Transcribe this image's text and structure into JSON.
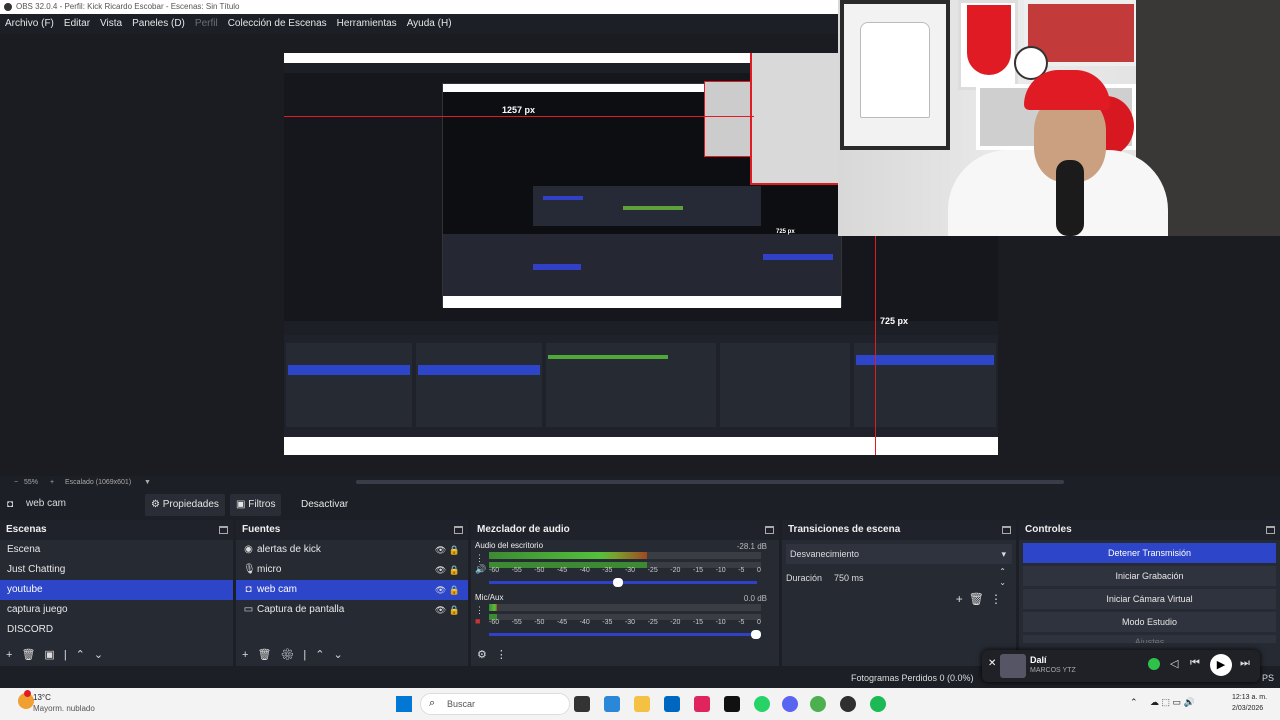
{
  "window": {
    "title": "OBS 32.0.4 - Perfil: Kick Ricardo Escobar - Escenas: Sin Título"
  },
  "menu": {
    "items": [
      "Archivo (F)",
      "Editar",
      "Vista",
      "Paneles (D)",
      "Perfil",
      "Colección de Escenas",
      "Herramientas",
      "Ayuda (H)"
    ]
  },
  "preview": {
    "label_width": "1257 px",
    "label_height": "725 px",
    "label_height_small": "725 px",
    "zoom": "55%",
    "scale_label": "Escalado (1069x601)"
  },
  "source_toolbar": {
    "source_name": "web cam",
    "properties": "Propiedades",
    "filters": "Filtros",
    "deactivate": "Desactivar"
  },
  "scenes": {
    "title": "Escenas",
    "items": [
      "Escena",
      "Just Chatting",
      "youtube",
      "captura juego",
      "DISCORD"
    ],
    "selected": "youtube"
  },
  "sources": {
    "title": "Fuentes",
    "items": [
      {
        "name": "alertas de kick",
        "icon": "globe-icon"
      },
      {
        "name": "micro",
        "icon": "microphone-icon"
      },
      {
        "name": "web cam",
        "icon": "camera-icon"
      },
      {
        "name": "Captura de pantalla",
        "icon": "monitor-icon"
      }
    ],
    "selected": "web cam"
  },
  "mixer": {
    "title": "Mezclador de audio",
    "channels": [
      {
        "name": "Audio del escritorio",
        "db": "-28.1 dB",
        "level": 0.58
      },
      {
        "name": "Mic/Aux",
        "db": "0.0 dB",
        "level": 0.03
      }
    ],
    "scale": [
      "-60",
      "-55",
      "-50",
      "-45",
      "-40",
      "-35",
      "-30",
      "-25",
      "-20",
      "-15",
      "-10",
      "-5",
      "0"
    ]
  },
  "transitions": {
    "title": "Transiciones de escena",
    "type": "Desvanecimiento",
    "duration_label": "Duración",
    "duration_value": "750 ms"
  },
  "controls": {
    "title": "Controles",
    "stop_stream": "Detener Transmisión",
    "start_recording": "Iniciar Grabación",
    "virtual_camera": "Iniciar Cámara Virtual",
    "studio_mode": "Modo Estudio",
    "settings_partial": "Ajustes"
  },
  "status": {
    "dropped_frames": "Fotogramas Perdidos 0 (0.0%)",
    "fps_partial": "PS"
  },
  "media": {
    "title": "Dalí",
    "artist": "MARCOS YTZ"
  },
  "taskbar": {
    "weather_temp": "13°C",
    "weather_desc": "Mayorm. nublado",
    "search_placeholder": "Buscar",
    "time": "12:13 a. m.",
    "date": "2/03/2026"
  },
  "colors": {
    "accent": "#2d45c9",
    "bg": "#1d1f26",
    "dock": "#262a33",
    "alert_red": "#e01b24"
  }
}
